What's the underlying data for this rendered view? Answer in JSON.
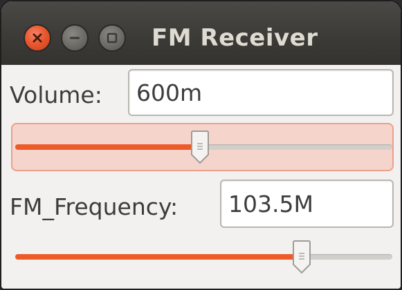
{
  "window": {
    "title": "FM Receiver"
  },
  "volume": {
    "label": "Volume:",
    "value": "600m",
    "slider_fraction": 0.49
  },
  "frequency": {
    "label": "FM_Frequency:",
    "value": "103.5M",
    "slider_fraction": 0.76
  },
  "colors": {
    "accent": "#ec5b28",
    "close_button": "#e9582f",
    "titlebar": "#3c3b37",
    "focus_highlight": "#f5d4cb"
  },
  "icons": {
    "close": "close-icon",
    "minimize": "minimize-icon",
    "maximize": "maximize-icon",
    "slider_grip": "grip-icon"
  }
}
